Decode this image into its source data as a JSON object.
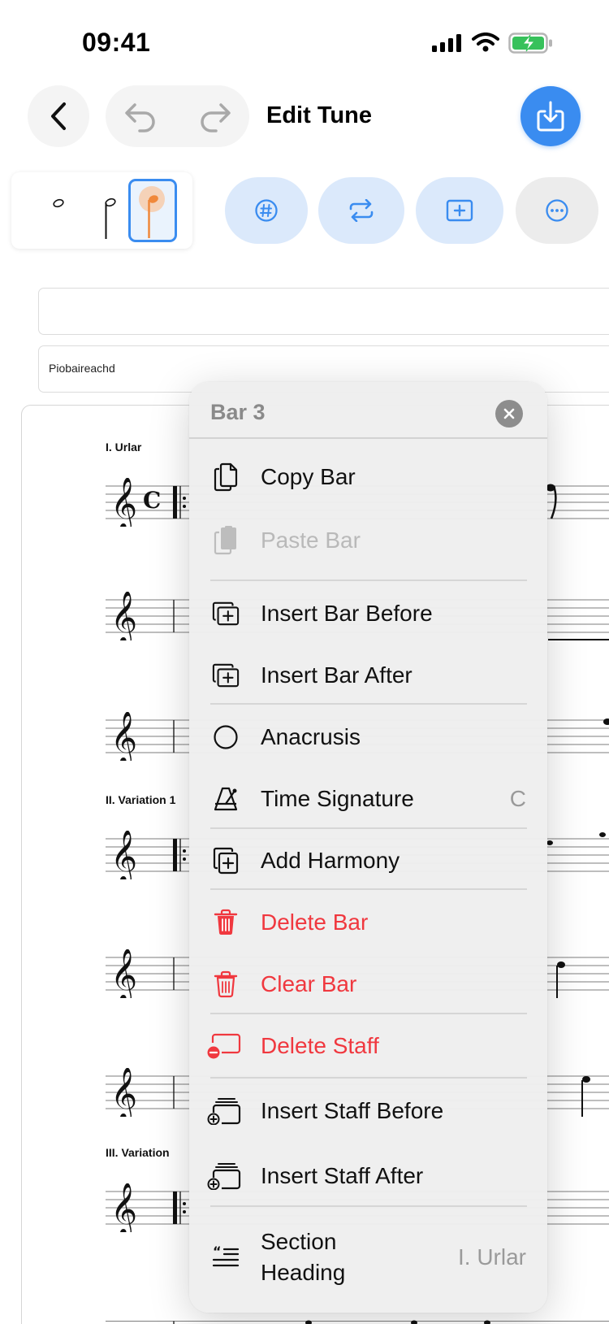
{
  "status_bar": {
    "time": "09:41"
  },
  "nav": {
    "title": "Edit Tune",
    "back_icon": "chevron-left-icon",
    "undo_icon": "undo-icon",
    "redo_icon": "redo-icon",
    "export_icon": "download-tray-icon"
  },
  "toolbar": {
    "notes": [
      "half-note",
      "quarter-note",
      "eighth-note-selected"
    ],
    "buttons": [
      "accidental-icon",
      "repeat-icon",
      "add-bar-icon",
      "more-icon"
    ]
  },
  "fields": {
    "field1_value": "",
    "field2_value": "Piobaireachd"
  },
  "sheet": {
    "sections": [
      "I. Urlar",
      "II. Variation 1",
      "III. Variation"
    ],
    "time_signature": "C"
  },
  "menu": {
    "title": "Bar 3",
    "items": [
      {
        "label": "Copy Bar",
        "icon": "copy-icon"
      },
      {
        "label": "Paste Bar",
        "icon": "paste-icon",
        "disabled": true
      },
      {
        "label": "Insert Bar Before",
        "icon": "insert-bar-icon"
      },
      {
        "label": "Insert Bar After",
        "icon": "insert-bar-icon"
      },
      {
        "label": "Anacrusis",
        "icon": "circle-icon"
      },
      {
        "label": "Time Signature",
        "icon": "metronome-icon",
        "value": "C"
      },
      {
        "label": "Add Harmony",
        "icon": "add-harmony-icon"
      },
      {
        "label": "Delete Bar",
        "icon": "trash-icon",
        "destructive": true
      },
      {
        "label": "Clear Bar",
        "icon": "trash-outline-icon",
        "destructive": true
      },
      {
        "label": "Delete Staff",
        "icon": "delete-staff-icon",
        "destructive": true
      },
      {
        "label": "Insert Staff Before",
        "icon": "insert-staff-icon"
      },
      {
        "label": "Insert Staff After",
        "icon": "insert-staff-icon"
      },
      {
        "label_line1": "Section",
        "label_line2": "Heading",
        "icon": "section-heading-icon",
        "value": "I. Urlar"
      }
    ]
  },
  "colors": {
    "accent": "#3a8cf0",
    "destructive": "#f0383f",
    "orange_note": "#f0883a"
  }
}
